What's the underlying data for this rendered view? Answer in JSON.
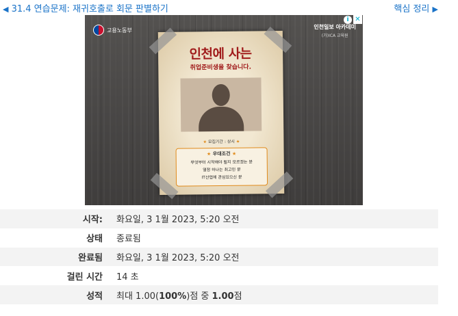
{
  "nav": {
    "prev_arrow": "◀",
    "prev_label": "31.4 연습문제: 재귀호출로 회문 판별하기",
    "next_label": "핵심 정리",
    "next_arrow": "▶"
  },
  "ad": {
    "logo_text": "고용노동부",
    "brand_name": "인천일보 아카데미",
    "brand_sub": "(가)ICA 교육원",
    "choices_icon": "i",
    "close_icon": "✕",
    "title": "인천에 사는",
    "subtitle": "취업준비생을 찾습니다.",
    "recruit_period_label": "모집기간 : 상시",
    "star_icon": "★",
    "conditions_title": "우대조건",
    "conditions": [
      "무엇부터 시작해야 될지 모르겠는 분",
      "열정 하나는 최고인 분",
      "IT산업에 관심있으신 분"
    ]
  },
  "summary": {
    "rows": [
      {
        "label": "시작:",
        "value": "화요일, 3 1월 2023, 5:20 오전"
      },
      {
        "label": "상태",
        "value": "종료됨"
      },
      {
        "label": "완료됨",
        "value": "화요일, 3 1월 2023, 5:20 오전"
      },
      {
        "label": "걸린 시간",
        "value": "14 초"
      }
    ],
    "grade": {
      "label": "성적",
      "prefix": "최대 1.00(",
      "percent": "100%",
      "middle": ")점 중 ",
      "score": "1.00",
      "suffix": "점"
    }
  }
}
